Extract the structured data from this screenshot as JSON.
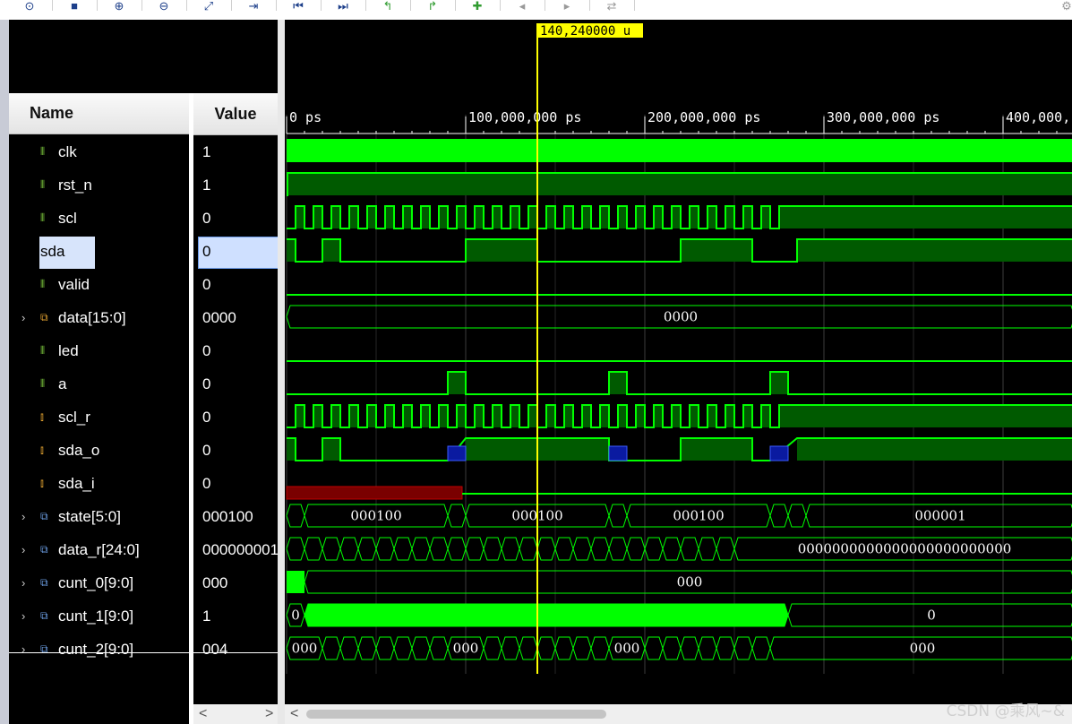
{
  "toolbar": {
    "buttons": [
      {
        "name": "zoom-fit-icon",
        "glyph": "⊙"
      },
      {
        "name": "save-icon",
        "glyph": "■"
      },
      {
        "name": "zoom-in-icon",
        "glyph": "⊕"
      },
      {
        "name": "zoom-out-icon",
        "glyph": "⊖"
      },
      {
        "name": "full-view-icon",
        "glyph": "⤢"
      },
      {
        "name": "goto-cursor-icon",
        "glyph": "⇥"
      },
      {
        "name": "goto-start-icon",
        "glyph": "⏮"
      },
      {
        "name": "goto-end-icon",
        "glyph": "⏭"
      },
      {
        "name": "prev-transition-icon",
        "glyph": "↰"
      },
      {
        "name": "next-transition-icon",
        "glyph": "↱"
      },
      {
        "name": "add-marker-icon",
        "glyph": "✚"
      },
      {
        "name": "prev-marker-icon",
        "glyph": "◂"
      },
      {
        "name": "next-marker-icon",
        "glyph": "▸"
      },
      {
        "name": "swap-cursors-icon",
        "glyph": "⇄"
      },
      {
        "name": "settings-icon",
        "glyph": "⚙"
      }
    ]
  },
  "headers": {
    "name": "Name",
    "value": "Value"
  },
  "cursor": {
    "label": "140,240000 u"
  },
  "time_axis": {
    "labels": [
      "0 ps",
      "100,000,000 ps",
      "200,000,000 ps",
      "300,000,000 ps",
      "400,000,"
    ]
  },
  "signals": [
    {
      "name": "clk",
      "value": "1",
      "icon": "bit-icon",
      "expandable": false
    },
    {
      "name": "rst_n",
      "value": "1",
      "icon": "bit-icon",
      "expandable": false
    },
    {
      "name": "scl",
      "value": "0",
      "icon": "bit-icon",
      "expandable": false
    },
    {
      "name": "sda",
      "value": "0",
      "icon": "bit-icon",
      "expandable": false
    },
    {
      "name": "valid",
      "value": "0",
      "icon": "bit-icon",
      "expandable": false
    },
    {
      "name": "data[15:0]",
      "value": "0000",
      "icon": "bus-icon",
      "expandable": true
    },
    {
      "name": "led",
      "value": "0",
      "icon": "bit-icon",
      "expandable": false
    },
    {
      "name": "a",
      "value": "0",
      "icon": "bit-icon",
      "expandable": false
    },
    {
      "name": "scl_r",
      "value": "0",
      "icon": "reg-icon",
      "expandable": false
    },
    {
      "name": "sda_o",
      "value": "0",
      "icon": "reg-icon",
      "expandable": false
    },
    {
      "name": "sda_i",
      "value": "0",
      "icon": "reg-icon",
      "expandable": false
    },
    {
      "name": "state[5:0]",
      "value": "000100",
      "icon": "reg-bus-icon",
      "expandable": true
    },
    {
      "name": "data_r[24:0]",
      "value": "000000001",
      "icon": "reg-bus-icon",
      "expandable": true
    },
    {
      "name": "cunt_0[9:0]",
      "value": "000",
      "icon": "reg-bus-icon",
      "expandable": true
    },
    {
      "name": "cunt_1[9:0]",
      "value": "1",
      "icon": "reg-bus-icon",
      "expandable": true
    },
    {
      "name": "cunt_2[9:0]",
      "value": "004",
      "icon": "reg-bus-icon",
      "expandable": true
    }
  ],
  "bus_labels": {
    "data": [
      "0000"
    ],
    "state": [
      "000100",
      "000100",
      "000100",
      "000001"
    ],
    "data_r": [
      "0000000000000000000000000"
    ],
    "cunt_0": [
      "000"
    ],
    "cunt_1": [
      "0",
      "0"
    ],
    "cunt_2": [
      "000",
      "000",
      "000",
      "000"
    ]
  },
  "colors": {
    "wave_green": "#00ff00",
    "wave_fill": "#005a00",
    "grid": "#3d3d3d",
    "cursor": "#ffff00",
    "sda_i_bar": "#7a0000",
    "highz": "#0a1aa0"
  },
  "watermark": "CSDN @乘风~&"
}
